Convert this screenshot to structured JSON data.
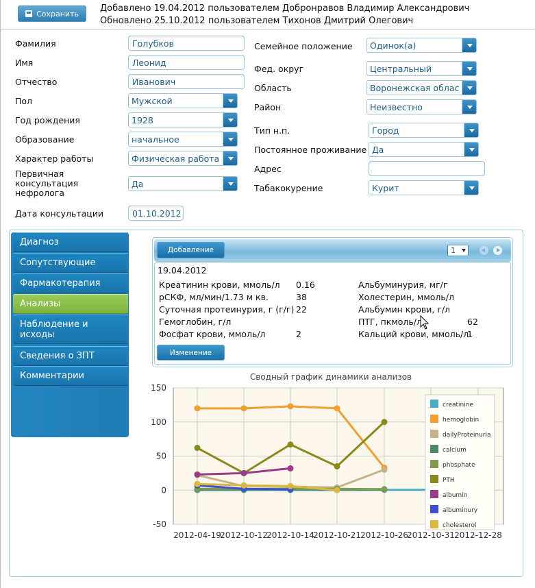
{
  "toolbar": {
    "save_label": "Сохранить"
  },
  "header": {
    "added": "Добавлено 19.04.2012 пользователем Добронравов Владимир Александрович",
    "updated": "Обновлено 25.10.2012 пользователем Тихонов Дмитрий Олегович"
  },
  "form": {
    "surname": {
      "label": "Фамилия",
      "value": "Голубков"
    },
    "name": {
      "label": "Имя",
      "value": "Леонид"
    },
    "patronymic": {
      "label": "Отчество",
      "value": "Иванович"
    },
    "sex": {
      "label": "Пол",
      "value": "Мужской"
    },
    "birth_year": {
      "label": "Год рождения",
      "value": "1928"
    },
    "education": {
      "label": "Образование",
      "value": "начальное"
    },
    "work": {
      "label": "Характер работы",
      "value": "Физическая работа"
    },
    "primary_consult": {
      "label": "Первичная консультация нефролога",
      "value": "Да"
    },
    "consult_date": {
      "label": "Дата консультации",
      "value": "01.10.2012"
    },
    "marital": {
      "label": "Семейное положение",
      "value": "Одинок(а)"
    },
    "fed_district": {
      "label": "Фед. округ",
      "value": "Центральный"
    },
    "region": {
      "label": "Область",
      "value": "Воронежская облас"
    },
    "district": {
      "label": "Район",
      "value": "Неизвестно"
    },
    "settlement_type": {
      "label": "Тип н.п.",
      "value": "Город"
    },
    "permanent": {
      "label": "Постоянное проживание",
      "value": "Да"
    },
    "address": {
      "label": "Адрес",
      "value": ""
    },
    "smoking": {
      "label": "Табакокурение",
      "value": "Курит"
    }
  },
  "sidebar": {
    "items": [
      {
        "label": "Диагноз"
      },
      {
        "label": "Сопутствующие"
      },
      {
        "label": "Фармакотерапия"
      },
      {
        "label": "Анализы"
      },
      {
        "label": "Наблюдение и исходы"
      },
      {
        "label": "Сведения о ЗПТ"
      },
      {
        "label": "Комментарии"
      }
    ],
    "active_index": 3
  },
  "analyses": {
    "add_label": "Добавление",
    "page": "1",
    "edit_label": "Изменение",
    "date": "19.04.2012",
    "left": [
      {
        "name": "Креатинин крови, ммоль/л",
        "value": "0.16"
      },
      {
        "name": "рСКФ, мл/мин/1.73 м кв.",
        "value": "38"
      },
      {
        "name": "Суточная протеинурия, г (г/г)",
        "value": "22"
      },
      {
        "name": "Гемоглобин, г/л",
        "value": ""
      },
      {
        "name": "Фосфат крови, ммоль/л",
        "value": "2"
      }
    ],
    "right": [
      {
        "name": "Альбуминурия, мг/г",
        "value": ""
      },
      {
        "name": "Холестерин, ммоль/л",
        "value": ""
      },
      {
        "name": "Альбумин крови, г/л",
        "value": ""
      },
      {
        "name": "ПТГ, пкмоль/л",
        "value": "62"
      },
      {
        "name": "Кальций крови, ммоль/л",
        "value": "1"
      }
    ]
  },
  "chart_data": {
    "type": "line",
    "title": "Сводный график динамики анализов",
    "categories": [
      "2012-04-19",
      "2012-10-12",
      "2012-10-14",
      "2012-10-21",
      "2012-10-26",
      "2012-10-31",
      "2012-12-28"
    ],
    "ylim": [
      -50,
      150
    ],
    "yticks": [
      -50,
      0,
      50,
      100,
      150
    ],
    "grid": true,
    "legend_position": "right",
    "series": [
      {
        "name": "creatinine",
        "color": "#4bacc6",
        "values": [
          0.16,
          0.2,
          0.2,
          0.2,
          0.5,
          0.5,
          1.5
        ]
      },
      {
        "name": "hemoglobin",
        "color": "#f0a030",
        "values": [
          120,
          120,
          123,
          120,
          33,
          null,
          null
        ]
      },
      {
        "name": "dailyProteinuria",
        "color": "#c4b48a",
        "values": [
          22,
          6,
          5,
          4,
          30,
          null,
          null
        ]
      },
      {
        "name": "calcium",
        "color": "#4e8a66",
        "values": [
          1,
          1,
          1,
          1,
          1,
          null,
          null
        ]
      },
      {
        "name": "phosphate",
        "color": "#7d9a4e",
        "values": [
          2,
          2,
          2,
          2,
          1.5,
          null,
          null
        ]
      },
      {
        "name": "PTH",
        "color": "#8a8a1a",
        "values": [
          62,
          25,
          67,
          35,
          100,
          null,
          null
        ]
      },
      {
        "name": "albumin",
        "color": "#993c8a",
        "values": [
          23,
          25,
          32,
          null,
          null,
          null,
          null
        ]
      },
      {
        "name": "albuminury",
        "color": "#3f4fd0",
        "values": [
          7,
          2,
          1,
          null,
          null,
          null,
          null
        ]
      },
      {
        "name": "cholesterol",
        "color": "#d8b840",
        "values": [
          9,
          7,
          6,
          0,
          null,
          null,
          null
        ]
      }
    ]
  }
}
